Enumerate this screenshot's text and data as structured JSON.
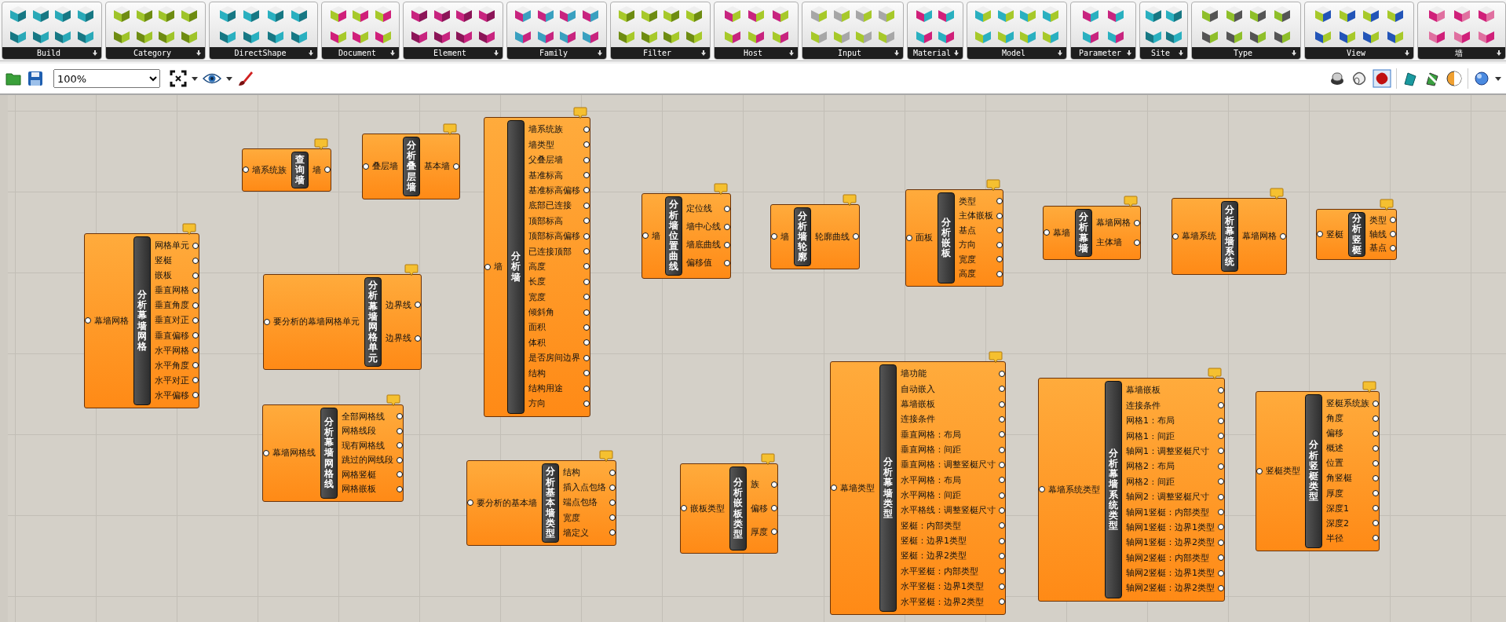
{
  "ribbon": {
    "groups": [
      {
        "label": "Build"
      },
      {
        "label": "Category"
      },
      {
        "label": "DirectShape"
      },
      {
        "label": "Document"
      },
      {
        "label": "Element"
      },
      {
        "label": "Family"
      },
      {
        "label": "Filter"
      },
      {
        "label": "Host"
      },
      {
        "label": "Input"
      },
      {
        "label": "Material"
      },
      {
        "label": "Model"
      },
      {
        "label": "Parameter"
      },
      {
        "label": "Site"
      },
      {
        "label": "Type"
      },
      {
        "label": "View"
      },
      {
        "label": "墙"
      }
    ]
  },
  "toolbar": {
    "zoom": "100%"
  },
  "canvas": {
    "components": [
      {
        "title": "分析幕墙网格",
        "inputs": [
          "幕墙网格"
        ],
        "outputs": [
          "网格单元",
          "竖梃",
          "嵌板",
          "垂直网格",
          "垂直角度",
          "垂直对正",
          "垂直偏移",
          "水平网格",
          "水平角度",
          "水平对正",
          "水平偏移"
        ]
      },
      {
        "title": "查询墙",
        "inputs": [
          "墙系统族"
        ],
        "outputs": [
          "墙"
        ]
      },
      {
        "title": "分析叠层墙",
        "inputs": [
          "叠层墙"
        ],
        "outputs": [
          "基本墙"
        ]
      },
      {
        "title": "分析墙",
        "inputs": [
          "墙"
        ],
        "outputs": [
          "墙系统族",
          "墙类型",
          "父叠层墙",
          "基准标高",
          "基准标高偏移",
          "底部已连接",
          "顶部标高",
          "顶部标高偏移",
          "已连接顶部",
          "高度",
          "长度",
          "宽度",
          "倾斜角",
          "面积",
          "体积",
          "是否房间边界",
          "结构",
          "结构用途",
          "方向"
        ]
      },
      {
        "title": "分析幕墙网格单元",
        "inputs": [
          "要分析的幕墙网格单元"
        ],
        "outputs": [
          "边界线",
          "边界线"
        ]
      },
      {
        "title": "分析幕墙网格线",
        "inputs": [
          "幕墙网格线"
        ],
        "outputs": [
          "全部网格线",
          "网格线段",
          "现有网格线",
          "跳过的网线段",
          "网格竖梃",
          "网格嵌板"
        ]
      },
      {
        "title": "分析基本墙类型",
        "inputs": [
          "要分析的基本墙"
        ],
        "outputs": [
          "结构",
          "插入点包络",
          "端点包络",
          "宽度",
          "墙定义"
        ]
      },
      {
        "title": "分析嵌板类型",
        "inputs": [
          "嵌板类型"
        ],
        "outputs": [
          "族",
          "偏移",
          "厚度"
        ]
      },
      {
        "title": "分析墙位置曲线",
        "inputs": [
          "墙"
        ],
        "outputs": [
          "定位线",
          "墙中心线",
          "墙底曲线",
          "偏移值"
        ]
      },
      {
        "title": "分析墙轮廓",
        "inputs": [
          "墙"
        ],
        "outputs": [
          "轮廓曲线"
        ]
      },
      {
        "title": "分析嵌板",
        "inputs": [
          "面板"
        ],
        "outputs": [
          "类型",
          "主体嵌板",
          "基点",
          "方向",
          "宽度",
          "高度"
        ]
      },
      {
        "title": "分析幕墙",
        "inputs": [
          "幕墙"
        ],
        "outputs": [
          "幕墙网格",
          "主体墙"
        ]
      },
      {
        "title": "分析幕墙系统",
        "inputs": [
          "幕墙系统"
        ],
        "outputs": [
          "幕墙网格"
        ]
      },
      {
        "title": "分析竖梃",
        "inputs": [
          "竖梃"
        ],
        "outputs": [
          "类型",
          "轴线",
          "基点"
        ]
      },
      {
        "title": "分析幕墙类型",
        "inputs": [
          "幕墙类型"
        ],
        "outputs": [
          "墙功能",
          "自动嵌入",
          "幕墙嵌板",
          "连接条件",
          "垂直网格：布局",
          "垂直网格：间距",
          "垂直网格：调整竖梃尺寸",
          "水平网格：布局",
          "水平网格：间距",
          "水平格线：调整竖梃尺寸",
          "竖梃：内部类型",
          "竖梃：边界1类型",
          "竖梃：边界2类型",
          "水平竖梃：内部类型",
          "水平竖梃：边界1类型",
          "水平竖梃：边界2类型"
        ]
      },
      {
        "title": "分析幕墙系统类型",
        "inputs": [
          "幕墙系统类型"
        ],
        "outputs": [
          "幕墙嵌板",
          "连接条件",
          "网格1：布局",
          "网格1 : 间距",
          "轴网1：调整竖梃尺寸",
          "网格2：布局",
          "网格2 : 间距",
          "轴网2：调整竖梃尺寸",
          "轴网1竖梃：内部类型",
          "轴网1竖梃：边界1类型",
          "轴网1竖梃：边界2类型",
          "轴网2竖梃：内部类型",
          "轴网2竖梃：边界1类型",
          "轴网2竖梃：边界2类型"
        ]
      },
      {
        "title": "分析竖梃类型",
        "inputs": [
          "竖梃类型"
        ],
        "outputs": [
          "竖梃系统族",
          "角度",
          "偏移",
          "概述",
          "位置",
          "角竖梃",
          "厚度",
          "深度1",
          "深度2",
          "半径"
        ]
      }
    ]
  }
}
